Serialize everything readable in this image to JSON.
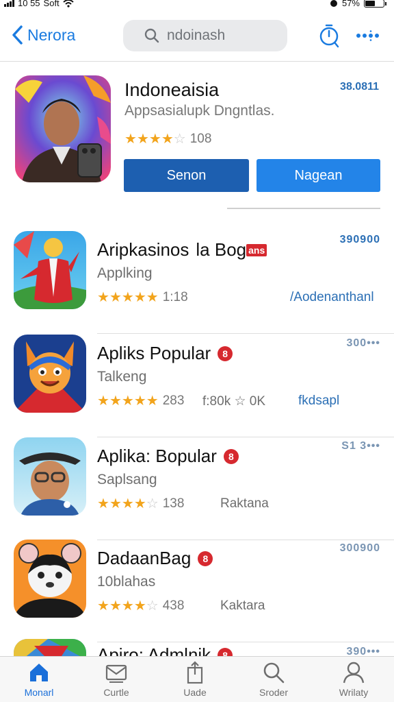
{
  "status_bar": {
    "time": "10 55",
    "carrier": "Soft",
    "battery": "57%",
    "battery_level": 0.57
  },
  "nav": {
    "back_label": "Nerora",
    "search_value": "ndoinash",
    "search_placeholder": "ndoinash"
  },
  "featured": {
    "title": "Indoneaisia",
    "subtitle": "Appsasialupk Dngntlas.",
    "price": "38.0811",
    "rating_count": "108",
    "rating_stars": 3.5,
    "primary_button": "Senon",
    "secondary_button": "Nagean"
  },
  "apps": [
    {
      "title": "Aripkasinos",
      "title_suffix": "la Bog",
      "badge": "ans",
      "subtitle": "Applking",
      "price": "390900",
      "rating_stars": 4.5,
      "rating_count": "1:18",
      "extra": "/Aodenanthanl"
    },
    {
      "title": "Apliks Popular",
      "badge": "8",
      "subtitle": "Talkeng",
      "price": "300•••",
      "rating_stars": 4.5,
      "rating_count": "283",
      "extra_mid": "f:80k ☆ 0K",
      "extra": "fkdsapl"
    },
    {
      "title": "Aplika: Bopular",
      "badge": "8",
      "subtitle": "Saplsang",
      "price": "S1 3•••",
      "rating_stars": 4,
      "rating_count": "138",
      "extra": "Raktana"
    },
    {
      "title": "DadaanBag",
      "badge": "8",
      "subtitle": "10blahas",
      "price": "300900",
      "rating_stars": 4,
      "rating_count": "438",
      "extra": "Kaktara"
    },
    {
      "title": "Apiro: Admlnik",
      "badge": "8",
      "price": "390•••"
    }
  ],
  "tabs": [
    {
      "label": "Monarl",
      "icon": "home-icon",
      "active": true
    },
    {
      "label": "Curtle",
      "icon": "mail-icon",
      "active": false
    },
    {
      "label": "Uade",
      "icon": "share-icon",
      "active": false
    },
    {
      "label": "Sroder",
      "icon": "search-icon",
      "active": false
    },
    {
      "label": "Wrilaty",
      "icon": "person-icon",
      "active": false
    }
  ],
  "colors": {
    "accent": "#1a7be0",
    "button_primary": "#1d5fb0",
    "button_secondary": "#2384e8",
    "star": "#f2a41c",
    "badge": "#d6292f"
  }
}
